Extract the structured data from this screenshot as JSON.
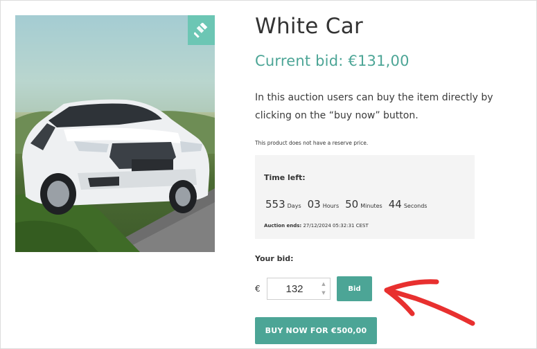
{
  "product": {
    "title": "White Car",
    "current_bid": "Current bid: €131,00",
    "description": "In this auction users can buy the item directly by clicking on the “buy now” button.",
    "reserve_note": "This product does not have a reserve price.",
    "image_icon": "car-photo",
    "badge_icon": "gavel-icon"
  },
  "timer": {
    "label": "Time left:",
    "days": "553",
    "days_unit": "Days",
    "hours": "03",
    "hours_unit": "Hours",
    "minutes": "50",
    "minutes_unit": "Minutes",
    "seconds": "44",
    "seconds_unit": "Seconds",
    "ends_label": "Auction ends:",
    "ends_value": "27/12/2024 05:32:31 CEST"
  },
  "bid_form": {
    "label": "Your bid:",
    "currency": "€",
    "value": "132",
    "bid_button": "Bid",
    "stepper_up_icon": "chevron-up-icon",
    "stepper_down_icon": "chevron-down-icon"
  },
  "buy_now": {
    "label": "BUY NOW FOR €500,00"
  },
  "colors": {
    "accent": "#4ca596",
    "badge": "#6cc6b4",
    "annotation_arrow": "#e8302f",
    "timer_background": "#f4f4f4"
  },
  "annotation": {
    "icon": "red-arrow-pointing-left"
  }
}
